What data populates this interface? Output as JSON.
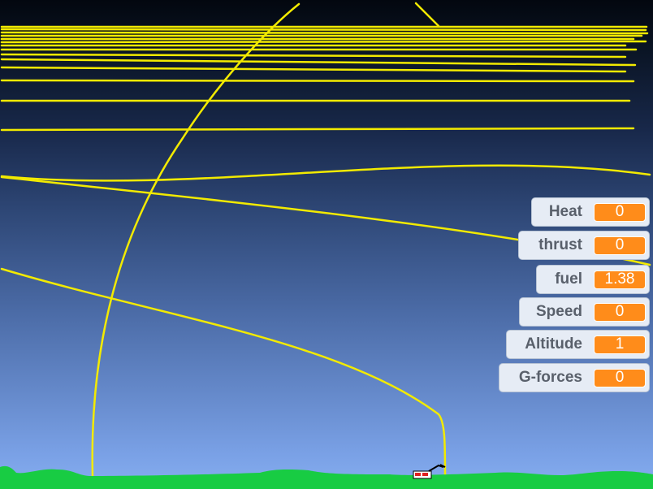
{
  "colors": {
    "trajectory": "#f2ea00",
    "ground": "#18cc43",
    "monitor_value_bg": "#ff8c1a",
    "monitor_bg": "#e6ecf5",
    "monitor_label": "#59606b"
  },
  "monitors": [
    {
      "label": "Heat",
      "value": "0"
    },
    {
      "label": "thrust",
      "value": "0"
    },
    {
      "label": "fuel",
      "value": "1.38"
    },
    {
      "label": "Speed",
      "value": "0"
    },
    {
      "label": "Altitude",
      "value": "1"
    },
    {
      "label": "G-forces",
      "value": "0"
    }
  ]
}
